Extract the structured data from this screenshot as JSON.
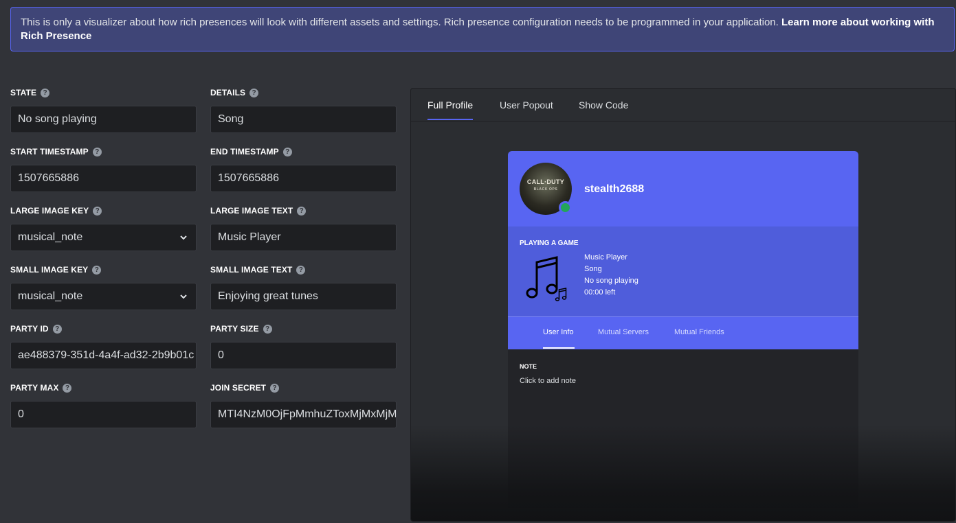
{
  "notice": {
    "text": "This is only a visualizer about how rich presences will look with different assets and settings. Rich presence configuration needs to be programmed in your application.",
    "link": "Learn more about working with Rich Presence"
  },
  "form": {
    "state": {
      "label": "STATE",
      "value": "No song playing"
    },
    "details": {
      "label": "DETAILS",
      "value": "Song"
    },
    "start_timestamp": {
      "label": "START TIMESTAMP",
      "value": "1507665886"
    },
    "end_timestamp": {
      "label": "END TIMESTAMP",
      "value": "1507665886"
    },
    "large_image_key": {
      "label": "LARGE IMAGE KEY",
      "value": "musical_note"
    },
    "large_image_text": {
      "label": "LARGE IMAGE TEXT",
      "value": "Music Player"
    },
    "small_image_key": {
      "label": "SMALL IMAGE KEY",
      "value": "musical_note"
    },
    "small_image_text": {
      "label": "SMALL IMAGE TEXT",
      "value": "Enjoying great tunes"
    },
    "party_id": {
      "label": "PARTY ID",
      "value": "ae488379-351d-4a4f-ad32-2b9b01c"
    },
    "party_size": {
      "label": "PARTY SIZE",
      "value": "0"
    },
    "party_max": {
      "label": "PARTY MAX",
      "value": "0"
    },
    "join_secret": {
      "label": "JOIN SECRET",
      "value": "MTI4NzM0OjFpMmhuZToxMjMxMjM"
    }
  },
  "preview": {
    "tabs": [
      "Full Profile",
      "User Popout",
      "Show Code"
    ],
    "username": "stealth2688",
    "avatar_text": "CALL·DUTY",
    "avatar_subtext": "BLACK OPS",
    "activity_header": "PLAYING A GAME",
    "activity_lines": [
      "Music Player",
      "Song",
      "No song playing",
      "00:00 left"
    ],
    "profile_tabs": [
      "User Info",
      "Mutual Servers",
      "Mutual Friends"
    ],
    "note_label": "NOTE",
    "note_placeholder": "Click to add note"
  },
  "colors": {
    "accent": "#5865f2",
    "online": "#23a55a",
    "background": "#313338"
  }
}
